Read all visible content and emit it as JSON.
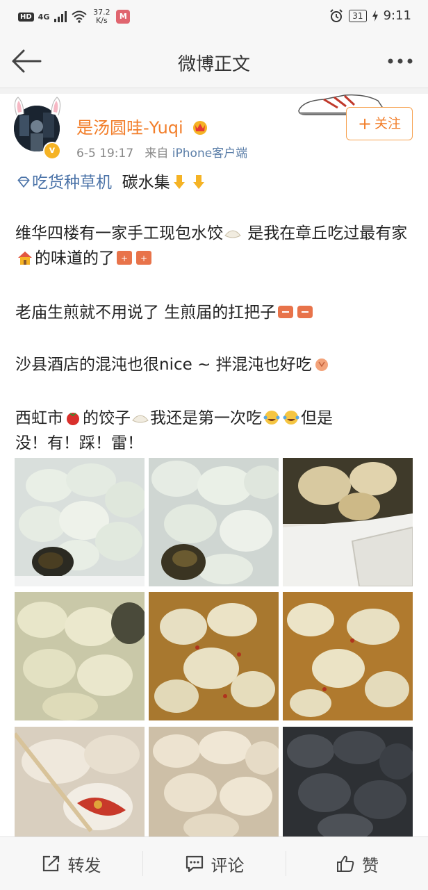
{
  "status_bar": {
    "network": "HD",
    "signal": "4G",
    "speed_value": "37.2",
    "speed_unit": "K/s",
    "battery": "31",
    "time": "9:11"
  },
  "nav": {
    "title": "微博正文"
  },
  "post": {
    "username": "是汤圆哇-Yuqi",
    "time": "6-5 19:17",
    "source_prefix": "来自",
    "source": "iPhone客户端",
    "follow_label": "关注",
    "topic": "吃货种草机",
    "line1_tail": "碳水集",
    "para1_a": "维华四楼有一家手工现包水饺",
    "para1_b": " 是我在章丘吃过最有家",
    "para1_c": "的味道的了",
    "para2": "老庙生煎就不用说了 生煎届的扛把子",
    "para3": "沙县酒店的混沌也很nice ~ 拌混沌也好吃",
    "para4_a": "西虹市",
    "para4_b": "的饺子",
    "para4_c": "我还是第一次吃",
    "para4_d": "但是",
    "para4_e": "没！有！踩！雷！",
    "photos": [
      "水饺1",
      "水饺2",
      "生煎",
      "混沌1",
      "混沌2",
      "混沌3",
      "饺子1",
      "饺子2",
      "饺子3"
    ]
  },
  "bottom_bar": {
    "repost_label": "转发",
    "comment_label": "评论",
    "like_label": "赞"
  },
  "colors": {
    "username": "#f27e2a",
    "topic": "#4b73a8",
    "source": "#5b7ea8",
    "follow_border": "#f6a04d"
  }
}
